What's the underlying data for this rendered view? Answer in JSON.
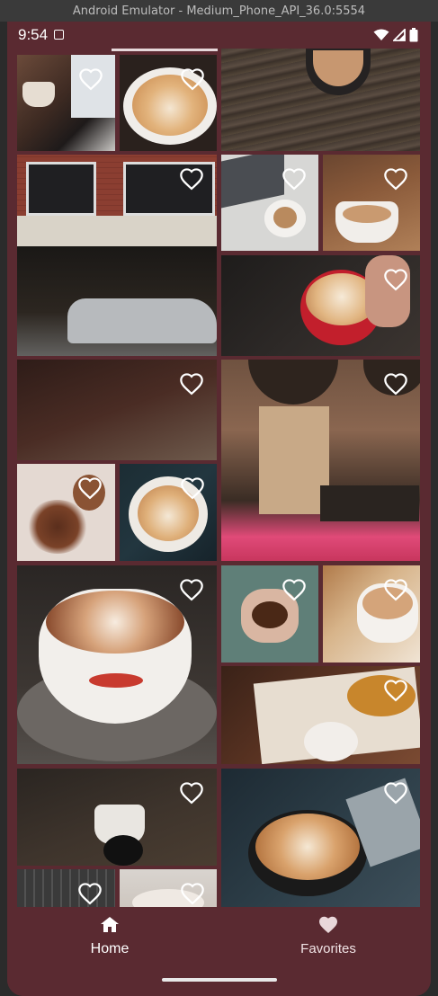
{
  "window": {
    "title": "Android Emulator - Medium_Phone_API_36.0:5554"
  },
  "status_bar": {
    "time": "9:54"
  },
  "nav": {
    "home_label": "Home",
    "favorites_label": "Favorites"
  },
  "colors": {
    "background": "#5a2a31",
    "accent": "#ffffff"
  },
  "icons": {
    "favorite": "heart-outline-icon",
    "home": "home-icon",
    "favorites": "heart-icon"
  },
  "photos": [
    {
      "name": "coffee-laptop-desk",
      "favorited": false
    },
    {
      "name": "latte-art-cup",
      "favorited": false
    },
    {
      "name": "coffee-on-wood-table",
      "favorited": false
    },
    {
      "name": "think-coffee-storefront",
      "favorited": false
    },
    {
      "name": "laptop-cappuccino",
      "favorited": false
    },
    {
      "name": "latte-mug-counter",
      "favorited": false
    },
    {
      "name": "red-cup-latte-hands",
      "favorited": false
    },
    {
      "name": "blurred-coffee-table",
      "favorited": false
    },
    {
      "name": "arcade-cafe-interior",
      "favorited": false
    },
    {
      "name": "coffee-beans-heart",
      "favorited": false
    },
    {
      "name": "latte-annual-magazine",
      "favorited": false
    },
    {
      "name": "heart-latte-saucer",
      "favorited": false
    },
    {
      "name": "hands-holding-beans",
      "favorited": false
    },
    {
      "name": "white-mug-beans",
      "favorited": false
    },
    {
      "name": "croissant-latte-board",
      "favorited": false
    },
    {
      "name": "nespresso-capsule-cup",
      "favorited": false
    },
    {
      "name": "pouring-latte-art",
      "favorited": false
    },
    {
      "name": "keyboard-closeup",
      "favorited": false
    },
    {
      "name": "cup-rim-closeup",
      "favorited": false
    }
  ]
}
